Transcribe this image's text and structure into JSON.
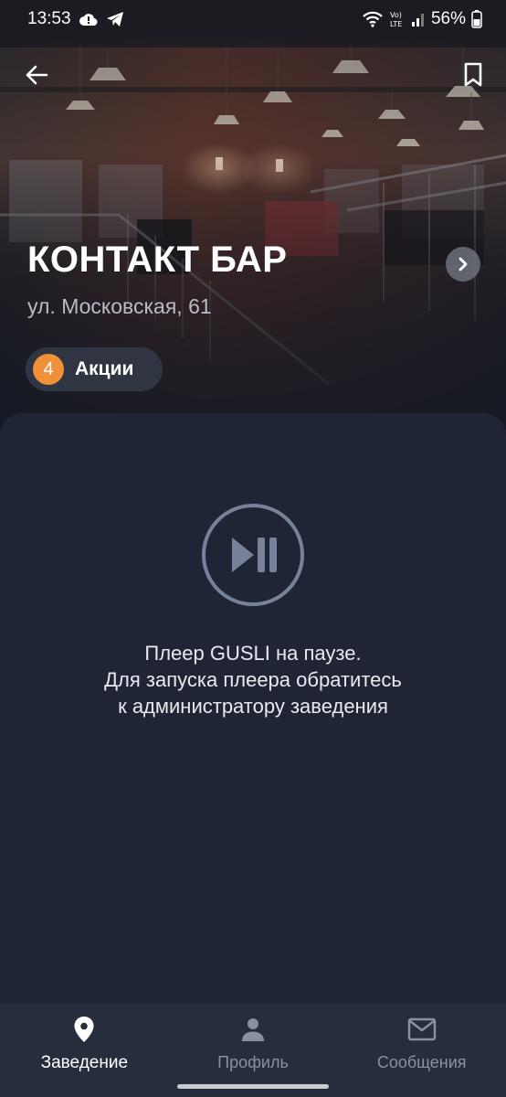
{
  "status_bar": {
    "time": "13:53",
    "battery": "56%",
    "icons": [
      "cloud-alert-icon",
      "telegram-icon",
      "wifi-icon",
      "volte-icon",
      "signal-icon",
      "battery-icon"
    ]
  },
  "venue": {
    "name": "КОНТАКТ БАР",
    "address": "ул. Московская, 61",
    "promo_count": "4",
    "promo_label": "Акции"
  },
  "player": {
    "icon": "play-pause-icon",
    "line1": "Плеер GUSLI на паузе.",
    "line2": "Для запуска плеера обратитесь",
    "line3": "к администратору заведения"
  },
  "nav": {
    "items": [
      {
        "label": "Заведение",
        "icon": "location-pin-icon",
        "active": true
      },
      {
        "label": "Профиль",
        "icon": "person-icon",
        "active": false
      },
      {
        "label": "Сообщения",
        "icon": "mail-icon",
        "active": false
      }
    ]
  },
  "colors": {
    "background": "#1e2433",
    "sheet": "#1f2535",
    "nav": "#262d3d",
    "promo_badge": "#f0913a",
    "inactive": "#8a909d"
  }
}
